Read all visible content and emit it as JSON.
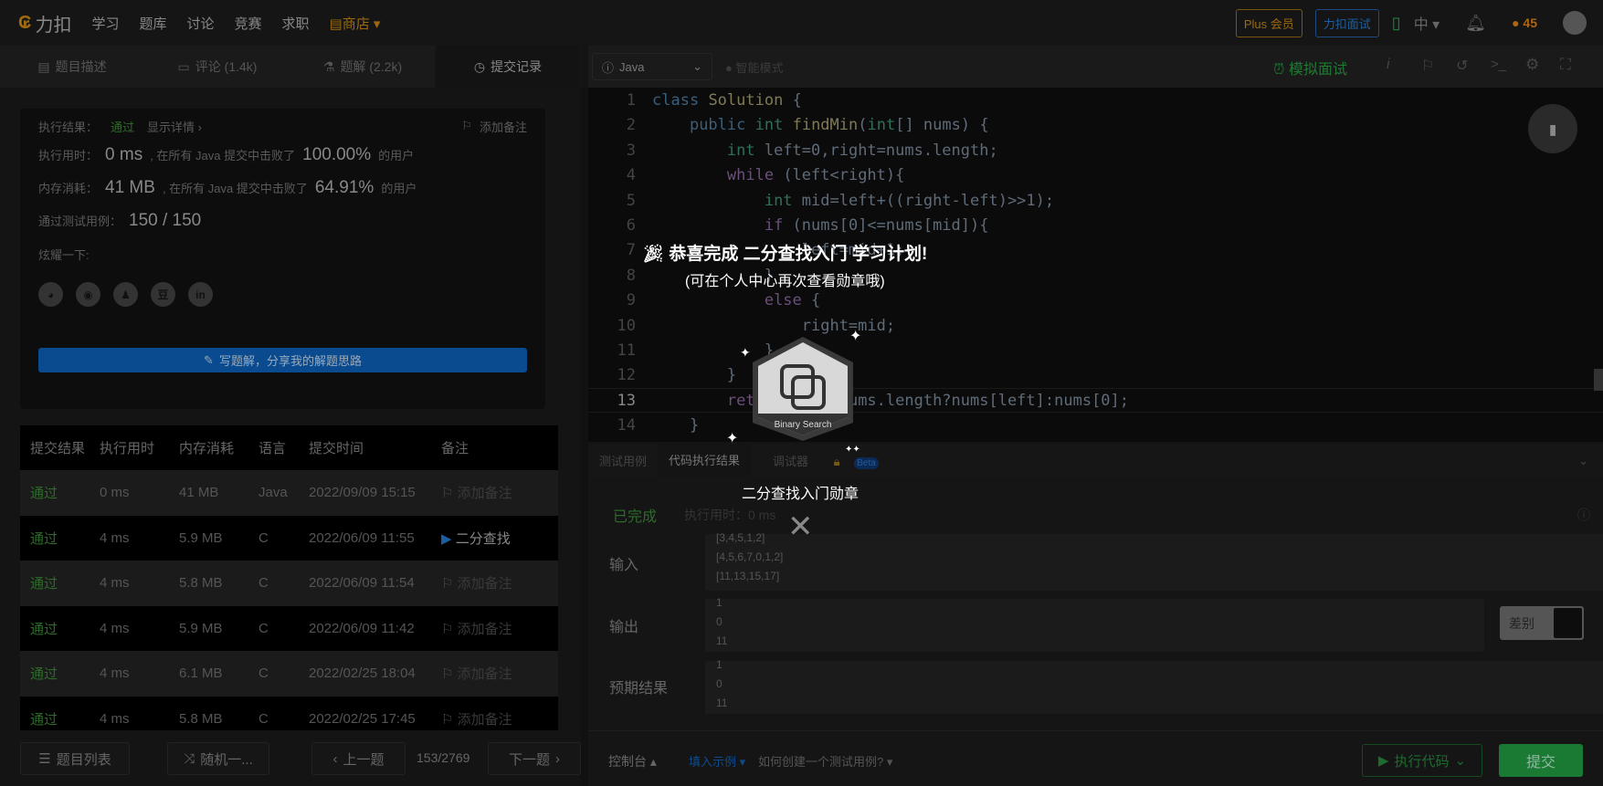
{
  "topbar": {
    "logo": "力扣",
    "nav": [
      "学习",
      "题库",
      "讨论",
      "竞赛",
      "求职"
    ],
    "shop": "商店",
    "plus": "Plus 会员",
    "interview": "力扣面试",
    "lang": "中",
    "streak": "45"
  },
  "tabs": [
    {
      "label": "题目描述"
    },
    {
      "label": "评论 (1.4k)"
    },
    {
      "label": "题解 (2.2k)"
    },
    {
      "label": "提交记录"
    }
  ],
  "result": {
    "result_label": "执行结果：",
    "status": "通过",
    "details": "显示详情 ›",
    "add_note": "添加备注",
    "time_label": "执行用时：",
    "time": "0 ms",
    "time_text": ", 在所有 Java 提交中击败了",
    "time_pct": "100.00%",
    "users": "的用户",
    "mem_label": "内存消耗：",
    "mem": "41 MB",
    "mem_text": ", 在所有 Java 提交中击败了",
    "mem_pct": "64.91%",
    "cases_label": "通过测试用例：",
    "cases": "150 / 150",
    "share_label": "炫耀一下:",
    "share_icons": [
      "wechat",
      "weibo",
      "qq",
      "douban",
      "in"
    ],
    "write_btn": "写题解，分享我的解题思路"
  },
  "table": {
    "headers": [
      "提交结果",
      "执行用时",
      "内存消耗",
      "语言",
      "提交时间",
      "备注"
    ],
    "rows": [
      [
        "通过",
        "0 ms",
        "41 MB",
        "Java",
        "2022/09/09 15:15",
        "添加备注"
      ],
      [
        "通过",
        "4 ms",
        "5.9 MB",
        "C",
        "2022/06/09 11:55",
        "二分查找"
      ],
      [
        "通过",
        "4 ms",
        "5.8 MB",
        "C",
        "2022/06/09 11:54",
        "添加备注"
      ],
      [
        "通过",
        "4 ms",
        "5.9 MB",
        "C",
        "2022/06/09 11:42",
        "添加备注"
      ],
      [
        "通过",
        "4 ms",
        "6.1 MB",
        "C",
        "2022/02/25 18:04",
        "添加备注"
      ],
      [
        "通过",
        "4 ms",
        "5.8 MB",
        "C",
        "2022/02/25 17:45",
        "添加备注"
      ]
    ]
  },
  "leftbottom": {
    "list": "题目列表",
    "random": "随机一...",
    "prev": "上一题",
    "counter": "153/2769",
    "next": "下一题"
  },
  "editor": {
    "language": "Java",
    "smart_mode": "智能模式",
    "mock": "模拟面试"
  },
  "code": [
    "class Solution {",
    "    public int findMin(int[] nums) {",
    "        int left=0,right=nums.length;",
    "        while (left<right){",
    "            int mid=left+((right-left)>>1);",
    "            if (nums[0]<=nums[mid]){",
    "                left=mid+1;",
    "            }",
    "            else {",
    "                right=mid;",
    "            }",
    "        }",
    "        return left<nums.length?nums[left]:nums[0];",
    "    }"
  ],
  "lowtabs": [
    "测试用例",
    "代码执行结果",
    "调试器",
    "Beta"
  ],
  "results": {
    "status": "已完成",
    "time": "执行用时：0 ms",
    "input_label": "输入",
    "input": [
      "[3,4,5,1,2]",
      "[4,5,6,7,0,1,2]",
      "[11,13,15,17]"
    ],
    "output_label": "输出",
    "output": [
      "1",
      "0",
      "11"
    ],
    "expected_label": "预期结果",
    "expected": [
      "1",
      "0",
      "11"
    ],
    "diff": "差别"
  },
  "rightbottom": {
    "console": "控制台",
    "fill": "填入示例",
    "howto": "如何创建一个测试用例?",
    "run": "执行代码",
    "submit": "提交"
  },
  "overlay": {
    "title": "恭喜完成 二分查找入门 学习计划!",
    "subtitle": "(可在个人中心再次查看勋章哦)",
    "badge_text": "Binary Search",
    "badge_name": "二分查找入门勋章"
  }
}
